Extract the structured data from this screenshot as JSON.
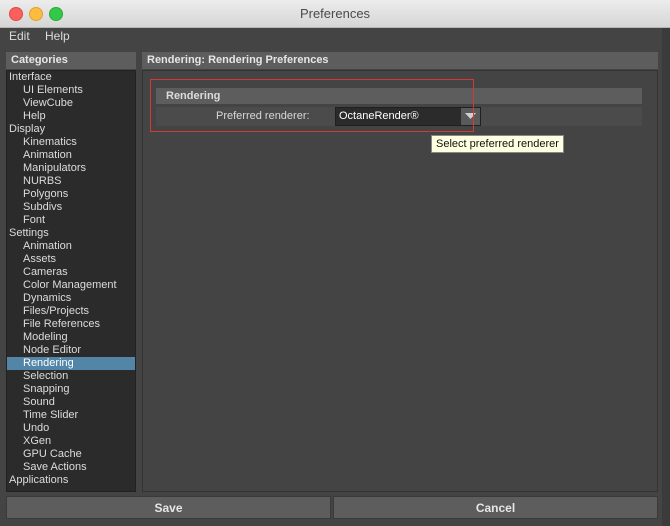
{
  "window": {
    "title": "Preferences"
  },
  "menu": {
    "items": [
      {
        "label": "Edit"
      },
      {
        "label": "Help"
      }
    ]
  },
  "categories": {
    "header": "Categories",
    "items": [
      {
        "label": "Interface",
        "level": 0
      },
      {
        "label": "UI Elements",
        "level": 1
      },
      {
        "label": "ViewCube",
        "level": 1
      },
      {
        "label": "Help",
        "level": 1
      },
      {
        "label": "Display",
        "level": 0
      },
      {
        "label": "Kinematics",
        "level": 1
      },
      {
        "label": "Animation",
        "level": 1
      },
      {
        "label": "Manipulators",
        "level": 1
      },
      {
        "label": "NURBS",
        "level": 1
      },
      {
        "label": "Polygons",
        "level": 1
      },
      {
        "label": "Subdivs",
        "level": 1
      },
      {
        "label": "Font",
        "level": 1
      },
      {
        "label": "Settings",
        "level": 0
      },
      {
        "label": "Animation",
        "level": 1
      },
      {
        "label": "Assets",
        "level": 1
      },
      {
        "label": "Cameras",
        "level": 1
      },
      {
        "label": "Color Management",
        "level": 1
      },
      {
        "label": "Dynamics",
        "level": 1
      },
      {
        "label": "Files/Projects",
        "level": 1
      },
      {
        "label": "File References",
        "level": 1
      },
      {
        "label": "Modeling",
        "level": 1
      },
      {
        "label": "Node Editor",
        "level": 1
      },
      {
        "label": "Rendering",
        "level": 1,
        "selected": true
      },
      {
        "label": "Selection",
        "level": 1
      },
      {
        "label": "Snapping",
        "level": 1
      },
      {
        "label": "Sound",
        "level": 1
      },
      {
        "label": "Time Slider",
        "level": 1
      },
      {
        "label": "Undo",
        "level": 1
      },
      {
        "label": "XGen",
        "level": 1
      },
      {
        "label": "GPU Cache",
        "level": 1
      },
      {
        "label": "Save Actions",
        "level": 1
      },
      {
        "label": "Applications",
        "level": 0
      }
    ]
  },
  "main": {
    "header": "Rendering: Rendering Preferences",
    "section": {
      "title": "Rendering",
      "renderer_label": "Preferred renderer:",
      "renderer_value": "OctaneRender®"
    },
    "tooltip": "Select preferred renderer"
  },
  "buttons": {
    "save": "Save",
    "cancel": "Cancel"
  },
  "colors": {
    "selection": "#5285a6",
    "highlight_border": "#d23a3a",
    "tooltip_bg": "#ffffe1"
  }
}
